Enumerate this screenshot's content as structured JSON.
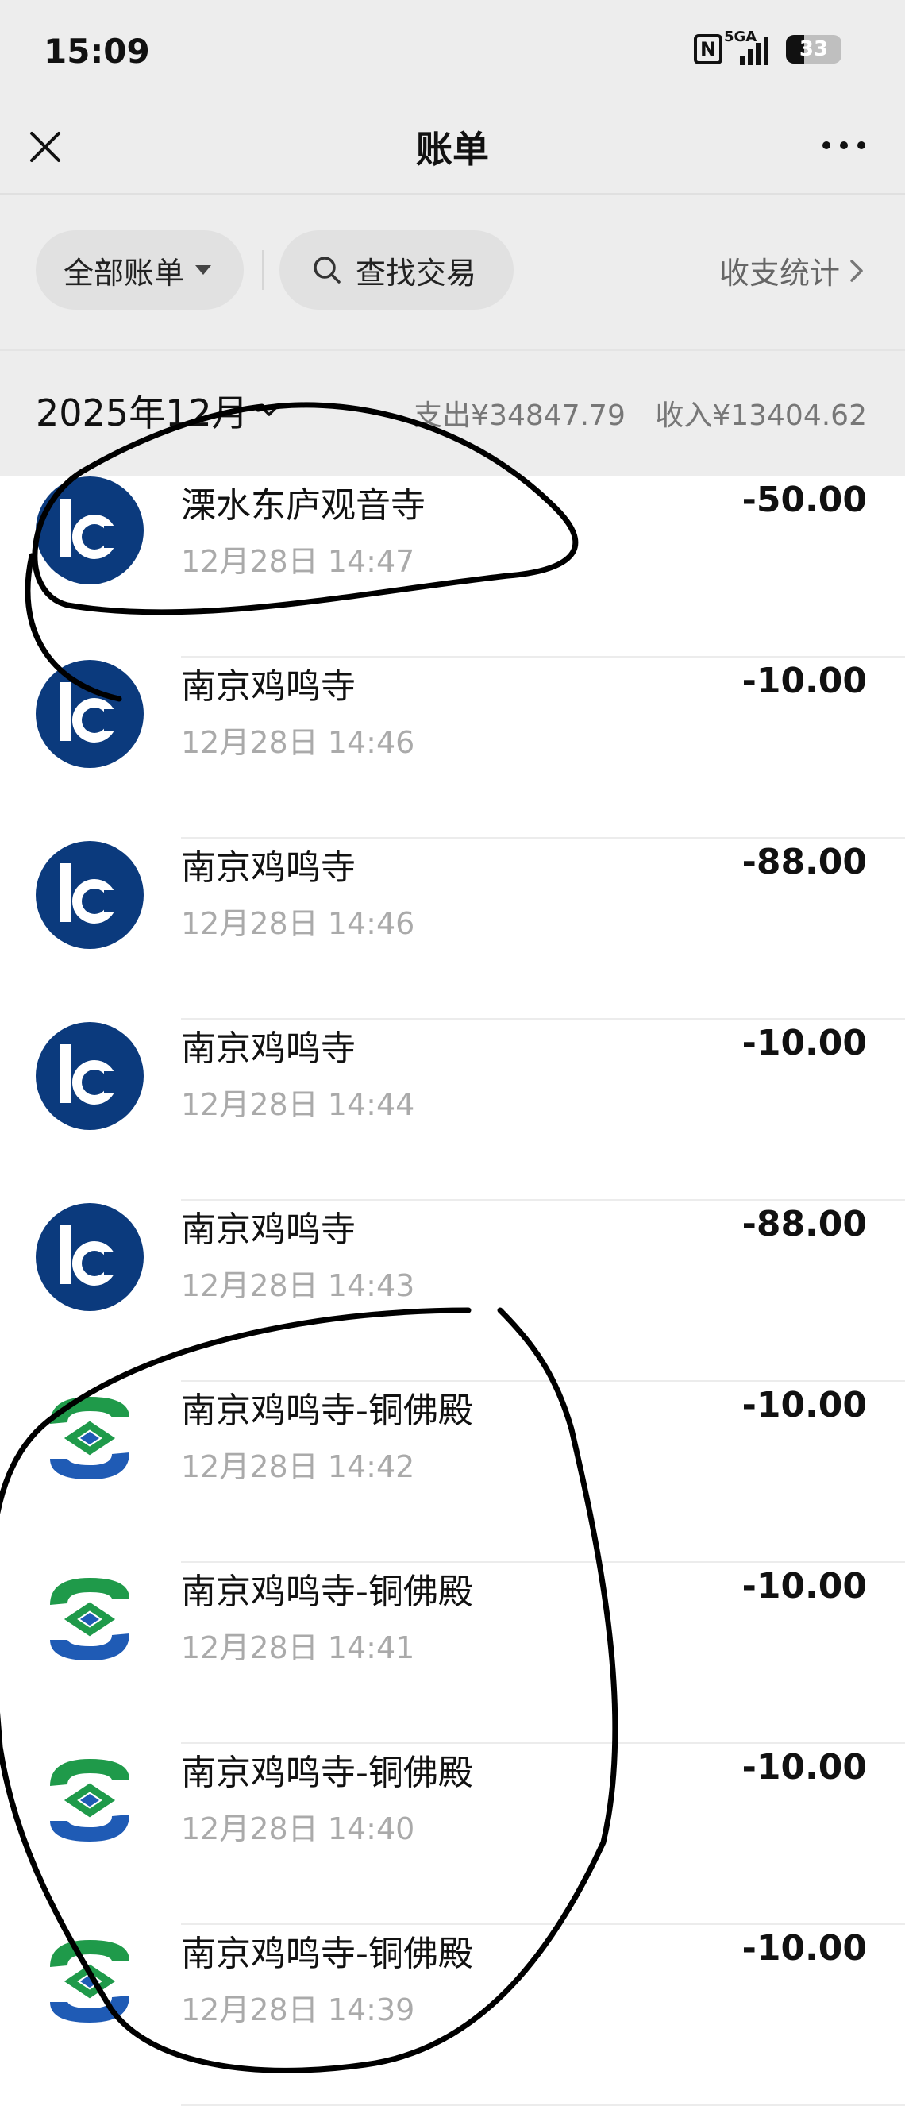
{
  "status_bar": {
    "time": "15:09",
    "nfc_label": "N",
    "network_label": "5GA",
    "battery_level": "33"
  },
  "nav": {
    "title": "账单",
    "close_icon": "close-icon",
    "more_icon": "more-icon"
  },
  "filters": {
    "all_bills": "全部账单",
    "search": "查找交易",
    "stats": "收支统计"
  },
  "summary": {
    "month": "2025年12月",
    "expense": "支出¥34847.79",
    "income": "收入¥13404.62"
  },
  "transactions": [
    {
      "name": "溧水东庐观音寺",
      "time": "12月28日 14:47",
      "amount": "-50.00",
      "logo": "bank-of-communications-icon"
    },
    {
      "name": "南京鸡鸣寺",
      "time": "12月28日 14:46",
      "amount": "-10.00",
      "logo": "bank-of-communications-icon"
    },
    {
      "name": "南京鸡鸣寺",
      "time": "12月28日 14:46",
      "amount": "-88.00",
      "logo": "bank-of-communications-icon"
    },
    {
      "name": "南京鸡鸣寺",
      "time": "12月28日 14:44",
      "amount": "-10.00",
      "logo": "bank-of-communications-icon"
    },
    {
      "name": "南京鸡鸣寺",
      "time": "12月28日 14:43",
      "amount": "-88.00",
      "logo": "bank-of-communications-icon"
    },
    {
      "name": "南京鸡鸣寺-铜佛殿",
      "time": "12月28日 14:42",
      "amount": "-10.00",
      "logo": "spdb-icon"
    },
    {
      "name": "南京鸡鸣寺-铜佛殿",
      "time": "12月28日 14:41",
      "amount": "-10.00",
      "logo": "spdb-icon"
    },
    {
      "name": "南京鸡鸣寺-铜佛殿",
      "time": "12月28日 14:40",
      "amount": "-10.00",
      "logo": "spdb-icon"
    },
    {
      "name": "南京鸡鸣寺-铜佛殿",
      "time": "12月28日 14:39",
      "amount": "-10.00",
      "logo": "spdb-icon"
    }
  ],
  "colors": {
    "header_bg": "#ededed",
    "boc_blue": "#0b3a7d",
    "spdb_green": "#1f9a4a",
    "spdb_blue": "#1f5bb5",
    "annotation_ink": "#000000"
  }
}
